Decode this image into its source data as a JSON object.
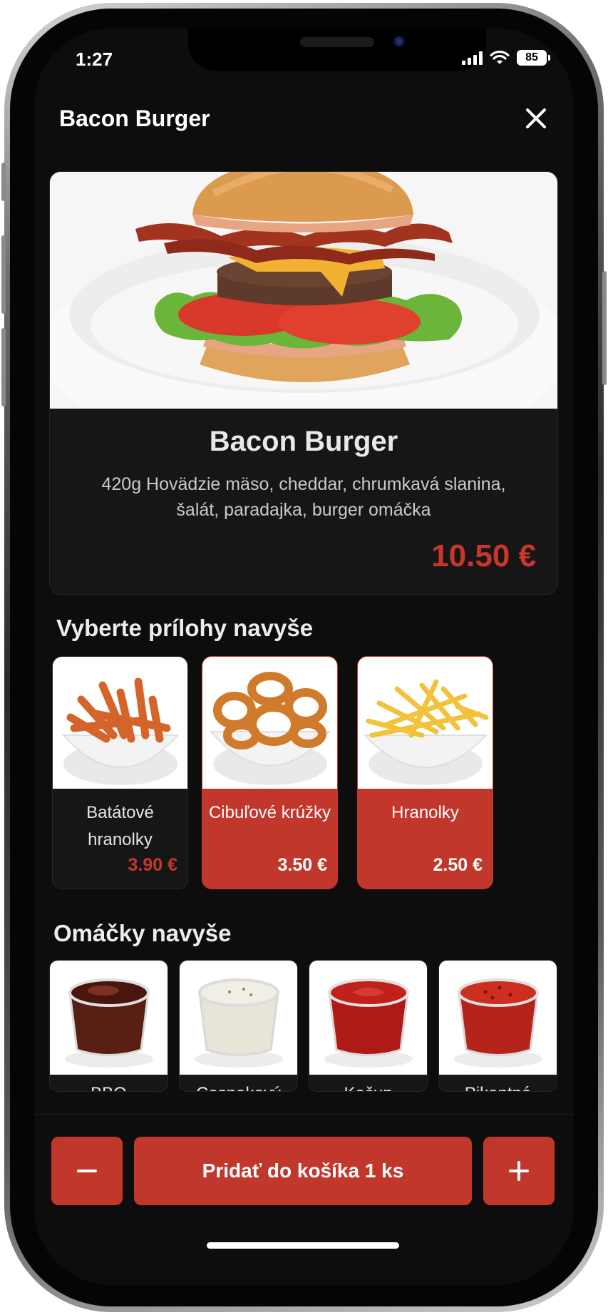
{
  "status_bar": {
    "time": "1:27",
    "battery": "85"
  },
  "header": {
    "title": "Bacon Burger"
  },
  "product": {
    "name": "Bacon Burger",
    "description": "420g Hovädzie mäso, cheddar, chrumkavá slanina, šalát, paradajka, burger omáčka",
    "price": "10.50 €"
  },
  "sides": {
    "title": "Vyberte prílohy navyše",
    "items": [
      {
        "name": "Batátové hranolky",
        "price": "3.90 €",
        "selected": false
      },
      {
        "name": "Cibuľové krúžky",
        "price": "3.50 €",
        "selected": true
      },
      {
        "name": "Hranolky",
        "price": "2.50 €",
        "selected": true
      }
    ]
  },
  "sauces": {
    "title": "Omáčky navyše",
    "items": [
      {
        "name": "BBQ"
      },
      {
        "name": "Cesnakový"
      },
      {
        "name": "Kečup"
      },
      {
        "name": "Pikantná"
      }
    ]
  },
  "cart": {
    "add_label": "Pridať do košíka 1 ks",
    "minus_icon": "minus-icon",
    "plus_icon": "plus-icon"
  },
  "colors": {
    "accent": "#c2372c",
    "price": "#c8362c",
    "background": "#0d0d0d"
  }
}
